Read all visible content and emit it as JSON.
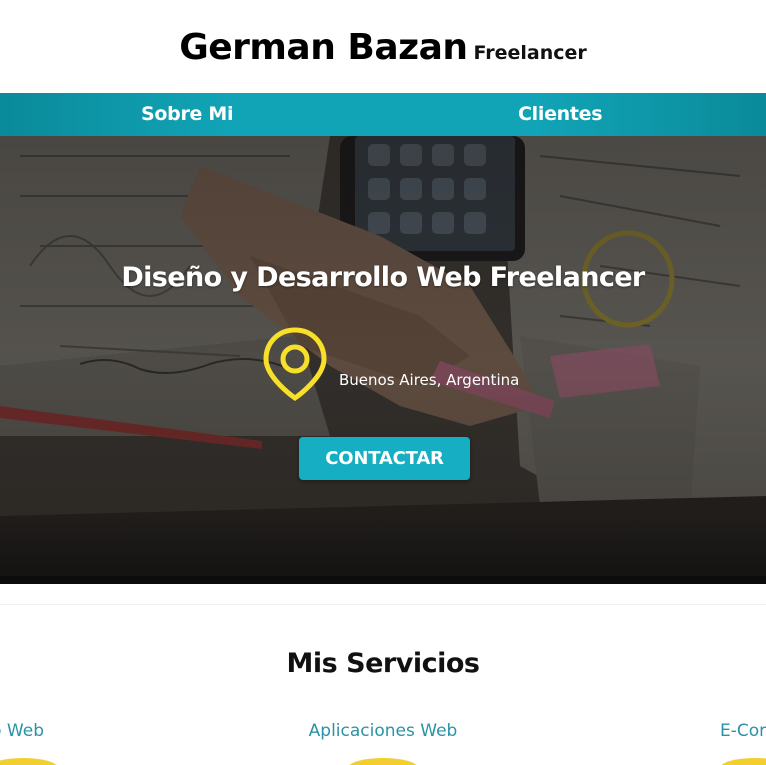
{
  "header": {
    "name": "German Bazan",
    "role": "Freelancer"
  },
  "nav": {
    "items": [
      {
        "label": "Sobre Mi"
      },
      {
        "label": "Clientes"
      }
    ]
  },
  "hero": {
    "title": "Diseño y Desarrollo Web Freelancer",
    "location_icon": "map-pin-icon",
    "location": "Buenos Aires, Argentina",
    "cta_label": "CONTACTAR"
  },
  "services": {
    "title": "Mis Servicios",
    "items": [
      {
        "label": "o Web"
      },
      {
        "label": "Aplicaciones Web"
      },
      {
        "label": "E-Cor"
      }
    ]
  },
  "colors": {
    "accent": "#16aec3",
    "nav": "#11a4b6",
    "link": "#2a92a8",
    "pin": "#f7df2a"
  }
}
